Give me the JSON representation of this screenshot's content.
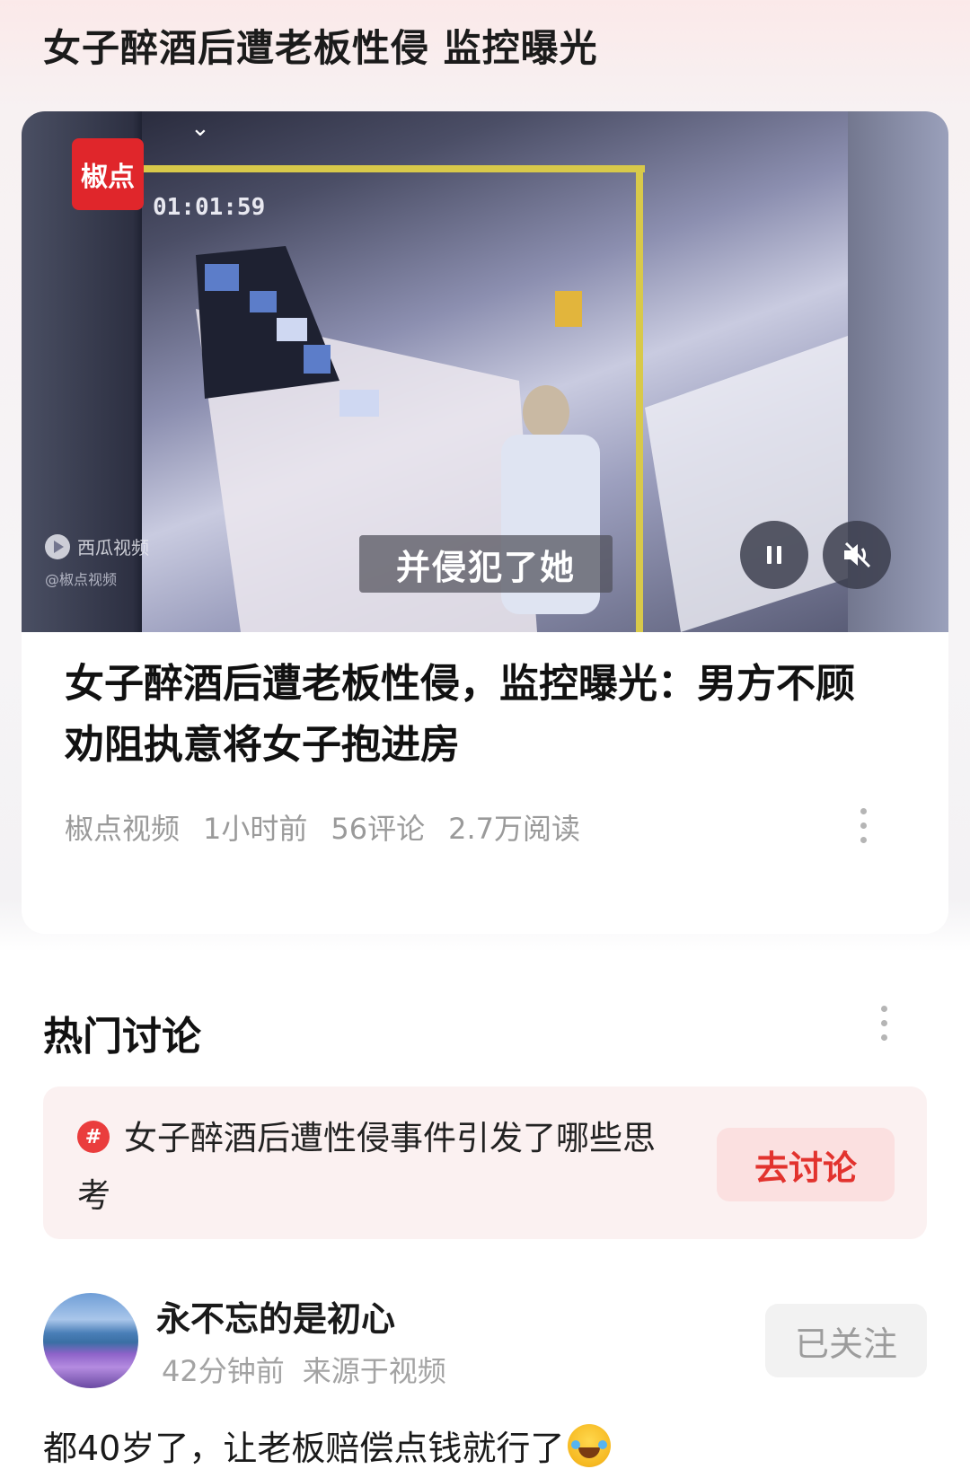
{
  "header": {
    "title": "女子醉酒后遭老板性侵 监控曝光"
  },
  "video": {
    "logo_text": "椒点",
    "timestamp": "01:01:59",
    "subtitle": "并侵犯了她",
    "watermark": "西瓜视频",
    "watermark_handle": "@椒点视频",
    "pause_icon": "pause-icon",
    "mute_icon": "mute-icon"
  },
  "article": {
    "title": "女子醉酒后遭老板性侵，监控曝光：男方不顾劝阻执意将女子抱进房",
    "source": "椒点视频",
    "time": "1小时前",
    "comments": "56评论",
    "reads": "2.7万阅读"
  },
  "discussion": {
    "section_title": "热门讨论",
    "topic": {
      "hash_symbol": "#",
      "text": "女子醉酒后遭性侵事件引发了哪些思考",
      "button": "去讨论"
    },
    "post": {
      "username": "永不忘的是初心",
      "time": "42分钟前",
      "source": "来源于视频",
      "follow_label": "已关注",
      "comment": "都40岁了，让老板赔偿点钱就行了"
    }
  },
  "colors": {
    "accent_red": "#e2332e",
    "topic_bg": "#fbf1f1",
    "meta_gray": "#9a9a9a"
  }
}
